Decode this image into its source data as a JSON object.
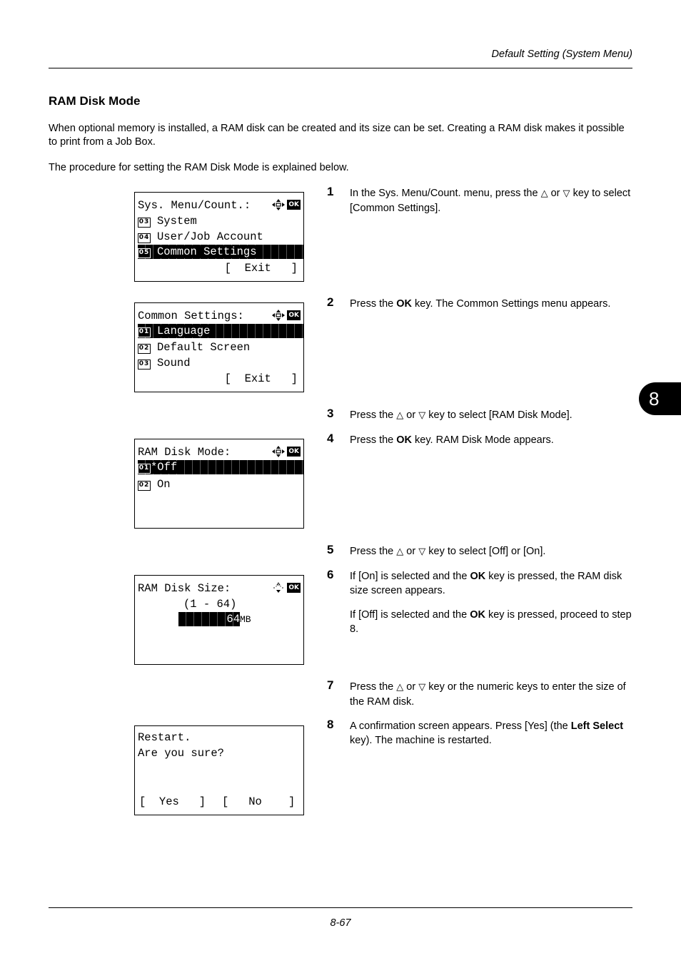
{
  "header": {
    "title": "Default Setting (System Menu)"
  },
  "section": {
    "title": "RAM Disk Mode",
    "intro": "When optional memory is installed, a RAM disk can be created and its size can be set. Creating a RAM disk makes it possible to print from a Job Box.",
    "procedure_intro": "The procedure for setting the RAM Disk Mode is explained below."
  },
  "chapter_tab": "8",
  "icons": {
    "up_key": "△",
    "down_key": "▽",
    "ok_label": "OK"
  },
  "screens": [
    {
      "title": "Sys. Menu/Count.:",
      "items": [
        {
          "num": "03",
          "label": "System",
          "selected": false
        },
        {
          "num": "04",
          "label": "User/Job Account",
          "selected": false
        },
        {
          "num": "05",
          "label": "Common Settings",
          "selected": true
        }
      ],
      "softkeys": "[  Exit   ]"
    },
    {
      "title": "Common Settings:",
      "items": [
        {
          "num": "01",
          "label": "Language",
          "selected": true
        },
        {
          "num": "02",
          "label": "Default Screen",
          "selected": false
        },
        {
          "num": "03",
          "label": "Sound",
          "selected": false
        }
      ],
      "softkeys": "[  Exit   ]"
    },
    {
      "title": "RAM Disk Mode:",
      "items": [
        {
          "num": "01",
          "label": "*Off",
          "selected": true
        },
        {
          "num": "02",
          "label": "On",
          "selected": false
        }
      ]
    },
    {
      "title": "RAM Disk Size:",
      "range": "(1 - 64)",
      "value": "64",
      "unit": "MB"
    },
    {
      "line1": "Restart.",
      "line2": "Are you sure?",
      "softkey_left": "[  Yes   ]",
      "softkey_right": "[   No    ]"
    }
  ],
  "steps": [
    {
      "num": "1",
      "parts": [
        "In the Sys. Menu/Count. menu, press the ",
        "△",
        " or ",
        "▽",
        " key to select [Common Settings]."
      ]
    },
    {
      "num": "2",
      "pre": "Press the ",
      "bold": "OK",
      "post": " key. The Common Settings menu appears."
    },
    {
      "num": "3",
      "parts": [
        "Press the ",
        "△",
        " or ",
        "▽",
        " key to select [RAM Disk Mode]."
      ]
    },
    {
      "num": "4",
      "pre": "Press the ",
      "bold": "OK",
      "post": " key. RAM Disk Mode appears."
    },
    {
      "num": "5",
      "parts": [
        "Press the ",
        "△",
        " or ",
        "▽",
        " key to select [Off] or [On]."
      ]
    },
    {
      "num": "6",
      "pre": "If [On] is selected and the ",
      "bold": "OK",
      "post": " key is pressed, the RAM disk size screen appears.",
      "pre2": "If [Off] is selected and the ",
      "bold2": "OK",
      "post2": " key is pressed, proceed to step 8."
    },
    {
      "num": "7",
      "parts": [
        "Press the ",
        "△",
        " or ",
        "▽",
        " key or the numeric keys to enter the size of the RAM disk."
      ]
    },
    {
      "num": "8",
      "pre": "A confirmation screen appears. Press [Yes] (the ",
      "bold": "Left Select",
      "post": " key). The machine is restarted."
    }
  ],
  "footer": {
    "page_number": "8-67"
  }
}
